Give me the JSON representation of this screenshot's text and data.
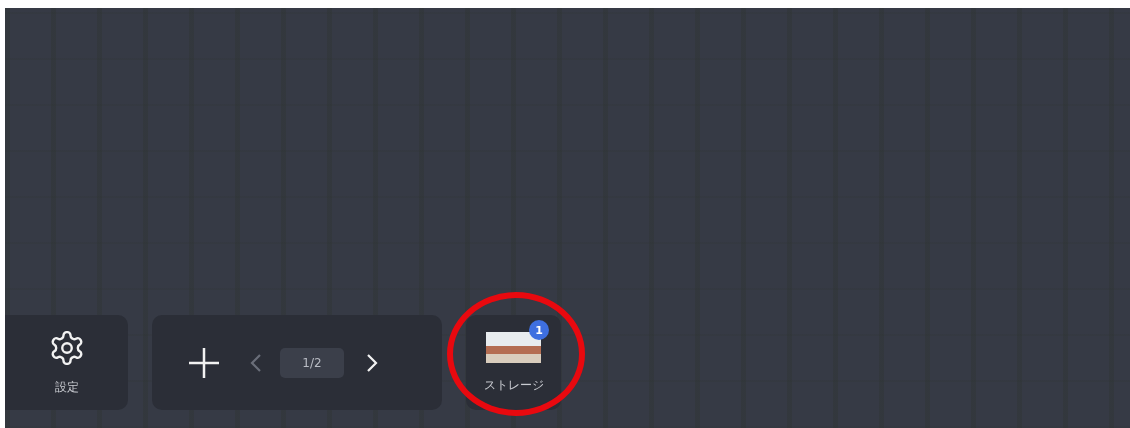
{
  "toolbar": {
    "settings": {
      "label": "設定"
    },
    "pager": {
      "page": "1/2",
      "prev": {
        "disabled": true
      },
      "next": {
        "disabled": false
      }
    },
    "storage": {
      "label": "ストレージ",
      "badge": "1",
      "circled": true
    }
  }
}
